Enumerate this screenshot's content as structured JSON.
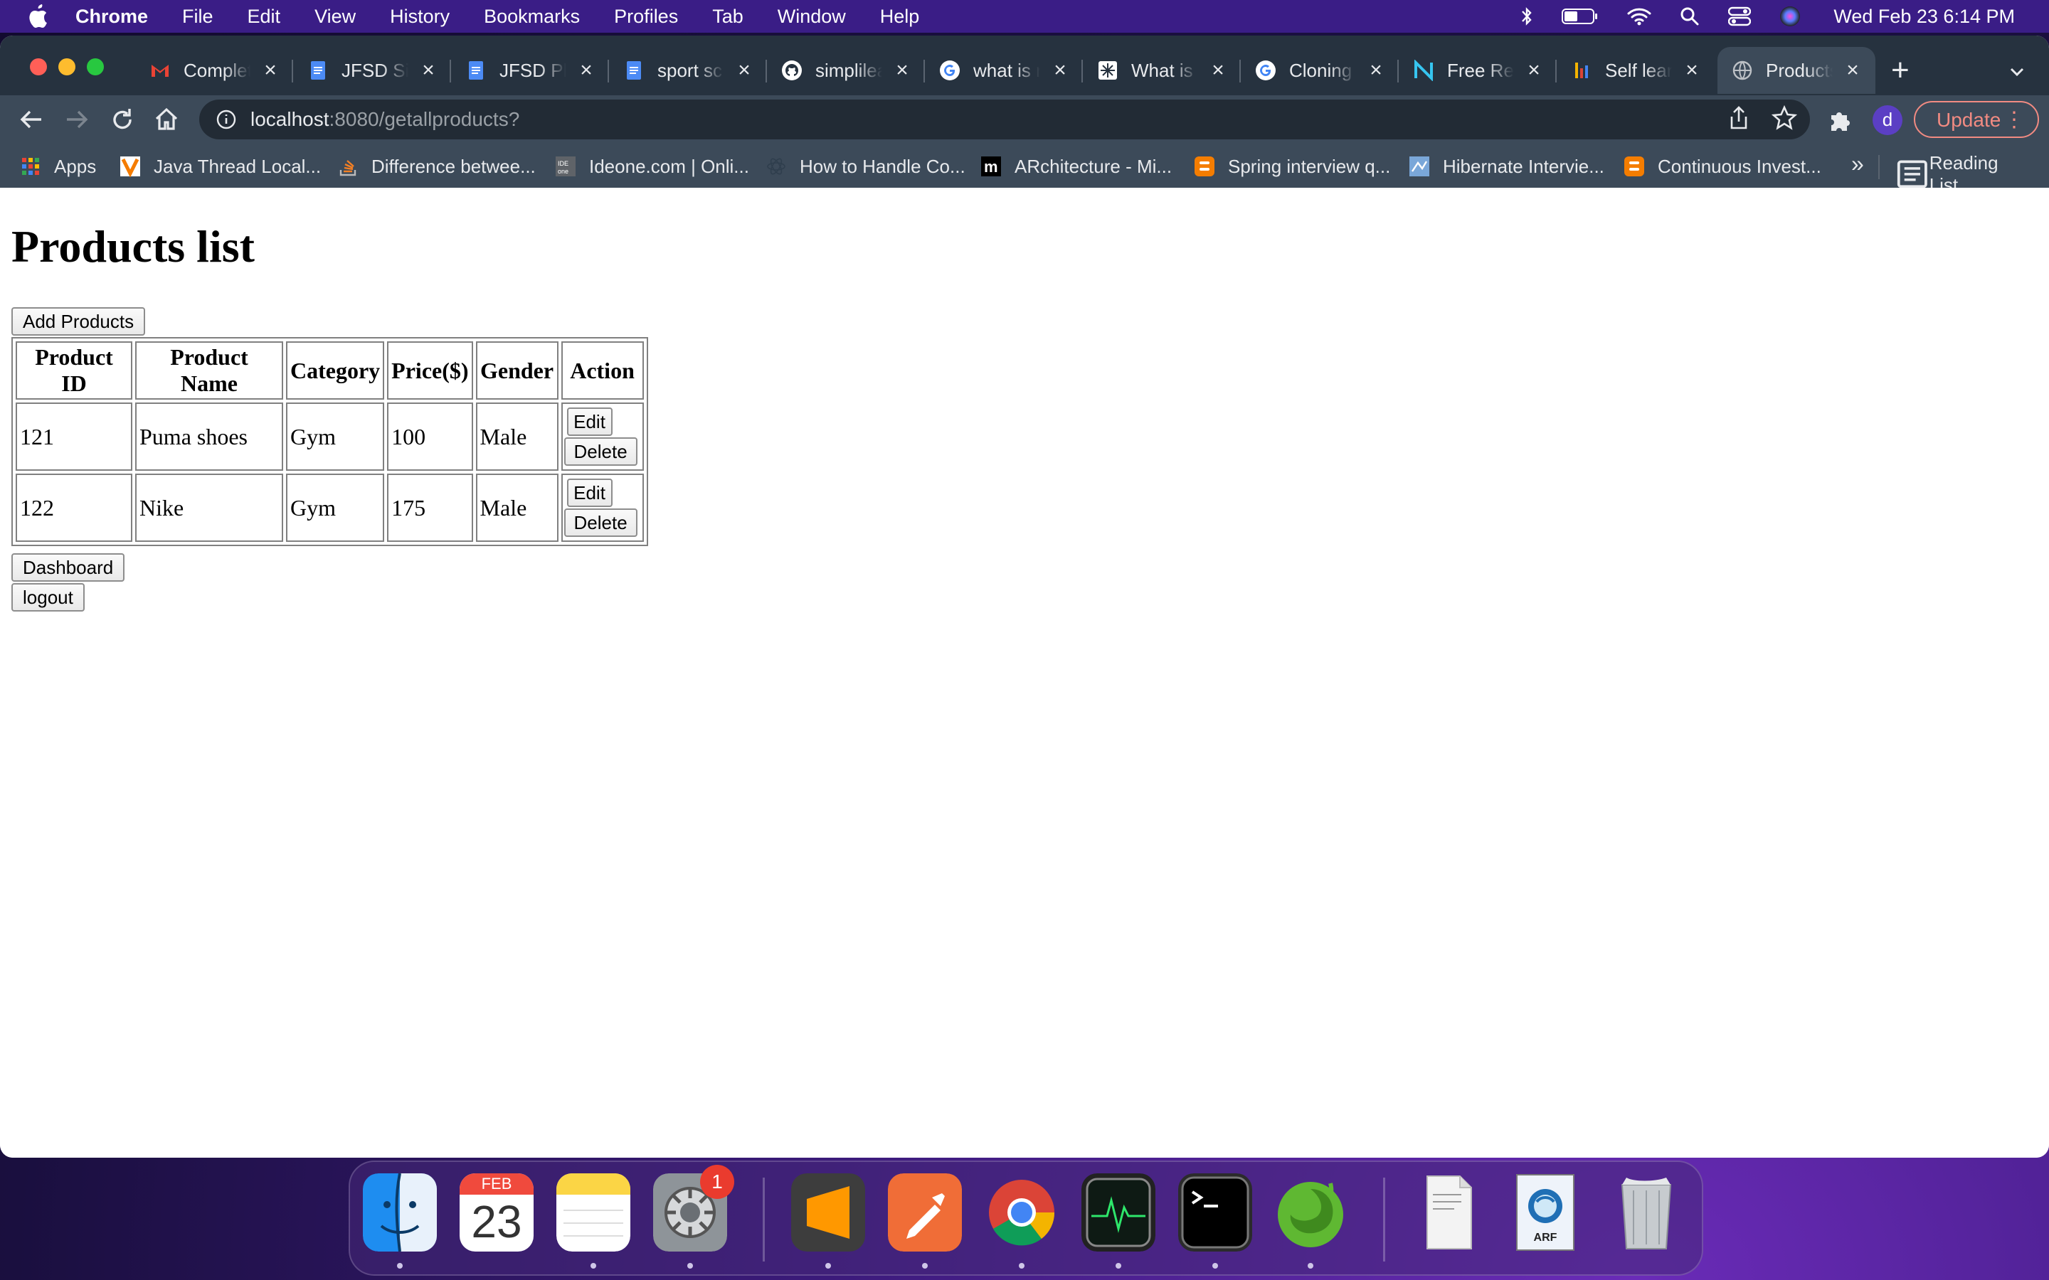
{
  "menubar": {
    "app_name": "Chrome",
    "menus": [
      "File",
      "Edit",
      "View",
      "History",
      "Bookmarks",
      "Profiles",
      "Tab",
      "Window",
      "Help"
    ],
    "clock": "Wed Feb 23  6:14 PM"
  },
  "tabs": [
    {
      "label": "Complet",
      "icon": "gmail-icon",
      "color": "#ea4335"
    },
    {
      "label": "JFSD Si",
      "icon": "docs-icon",
      "color": "#4c8bf5"
    },
    {
      "label": "JFSD Ph",
      "icon": "docs-icon",
      "color": "#4c8bf5"
    },
    {
      "label": "sport sc",
      "icon": "docs-icon",
      "color": "#4c8bf5"
    },
    {
      "label": "simplilea",
      "icon": "github-icon",
      "color": "#ffffff"
    },
    {
      "label": "what is r",
      "icon": "google-icon",
      "color": "#4285f4"
    },
    {
      "label": "What is",
      "icon": "site-icon",
      "color": "#ffffff"
    },
    {
      "label": "Cloning",
      "icon": "google-icon",
      "color": "#4285f4"
    },
    {
      "label": "Free Re",
      "icon": "n-logo-icon",
      "color": "#36c5f0"
    },
    {
      "label": "Self lear",
      "icon": "bars-icon",
      "color": "#f4b400"
    },
    {
      "label": "Products",
      "icon": "globe-icon",
      "color": "#bdc1c6",
      "active": true
    }
  ],
  "toolbar": {
    "url_host": "localhost",
    "url_rest": ":8080/getallproducts?",
    "avatar_letter": "d",
    "update_label": "Update"
  },
  "bookmarks": {
    "items": [
      {
        "label": "Apps",
        "icon": "apps-grid-icon"
      },
      {
        "label": "Java Thread Local...",
        "icon": "v-logo-icon"
      },
      {
        "label": "Difference betwee...",
        "icon": "stack-icon"
      },
      {
        "label": "Ideone.com | Onli...",
        "icon": "ideone-icon"
      },
      {
        "label": "How to Handle Co...",
        "icon": "react-icon"
      },
      {
        "label": "ARchitecture - Mi...",
        "icon": "m-logo-icon"
      },
      {
        "label": "Spring interview q...",
        "icon": "blogger-icon"
      },
      {
        "label": "Hibernate Intervie...",
        "icon": "hibernate-icon"
      },
      {
        "label": "Continuous Invest...",
        "icon": "blogger-icon"
      }
    ],
    "more": "»",
    "reading_list": "Reading List"
  },
  "page": {
    "title": "Products list",
    "add_button": "Add Products",
    "columns": [
      "Product ID",
      "Product Name",
      "Category",
      "Price($)",
      "Gender",
      "Action"
    ],
    "rows": [
      {
        "id": "121",
        "name": "Puma shoes",
        "category": "Gym",
        "price": "100",
        "gender": "Male"
      },
      {
        "id": "122",
        "name": "Nike",
        "category": "Gym",
        "price": "175",
        "gender": "Male"
      }
    ],
    "edit_label": "Edit",
    "delete_label": "Delete",
    "dashboard_button": "Dashboard",
    "logout_button": "logout"
  },
  "dock": {
    "calendar_month": "FEB",
    "calendar_day": "23",
    "settings_badge": "1",
    "arf_label": "ARF"
  }
}
